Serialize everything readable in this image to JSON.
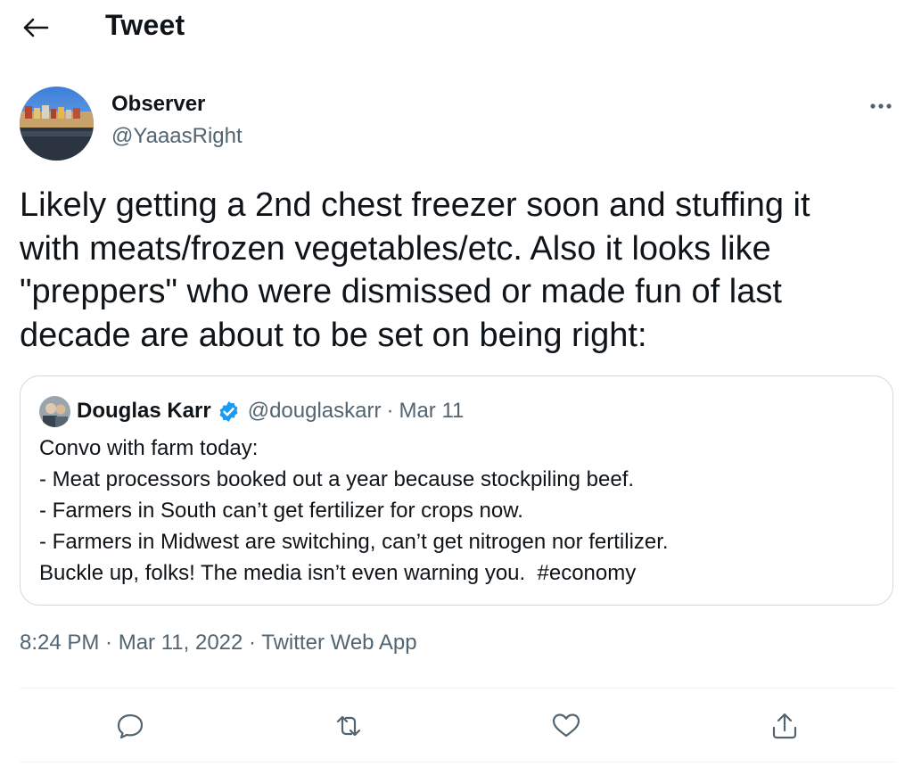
{
  "header": {
    "title": "Tweet",
    "back_icon": "arrow-left-icon"
  },
  "author": {
    "display_name": "Observer",
    "handle": "@YaaasRight"
  },
  "more_icon": "more-horizontal-icon",
  "tweet": {
    "text": "Likely getting a 2nd chest freezer soon and stuffing it\nwith meats/frozen vegetables/etc. Also it looks like\n\"preppers\" who were dismissed or made fun of last\ndecade are about to be set on being right:"
  },
  "quoted_tweet": {
    "display_name": "Douglas Karr",
    "verified_icon": "verified-badge-icon",
    "handle": "@douglaskarr",
    "separator": "·",
    "date": "Mar 11",
    "text": "Convo with farm today:\n- Meat processors booked out a year because stockpiling beef.\n- Farmers in South can’t get fertilizer for crops now.\n- Farmers in Midwest are switching, can’t get nitrogen nor fertilizer.\nBuckle up, folks! The media isn’t even warning you.  #economy"
  },
  "meta": {
    "time": "8:24 PM",
    "sep1": " · ",
    "date": "Mar 11, 2022",
    "sep2": " · ",
    "source": "Twitter Web App"
  },
  "actions": [
    {
      "icon": "reply-icon"
    },
    {
      "icon": "retweet-icon"
    },
    {
      "icon": "like-icon"
    },
    {
      "icon": "share-icon"
    }
  ],
  "colors": {
    "text_primary": "#0f1419",
    "text_secondary": "#536471",
    "border": "#cfd9de",
    "verified": "#1d9bf0"
  }
}
